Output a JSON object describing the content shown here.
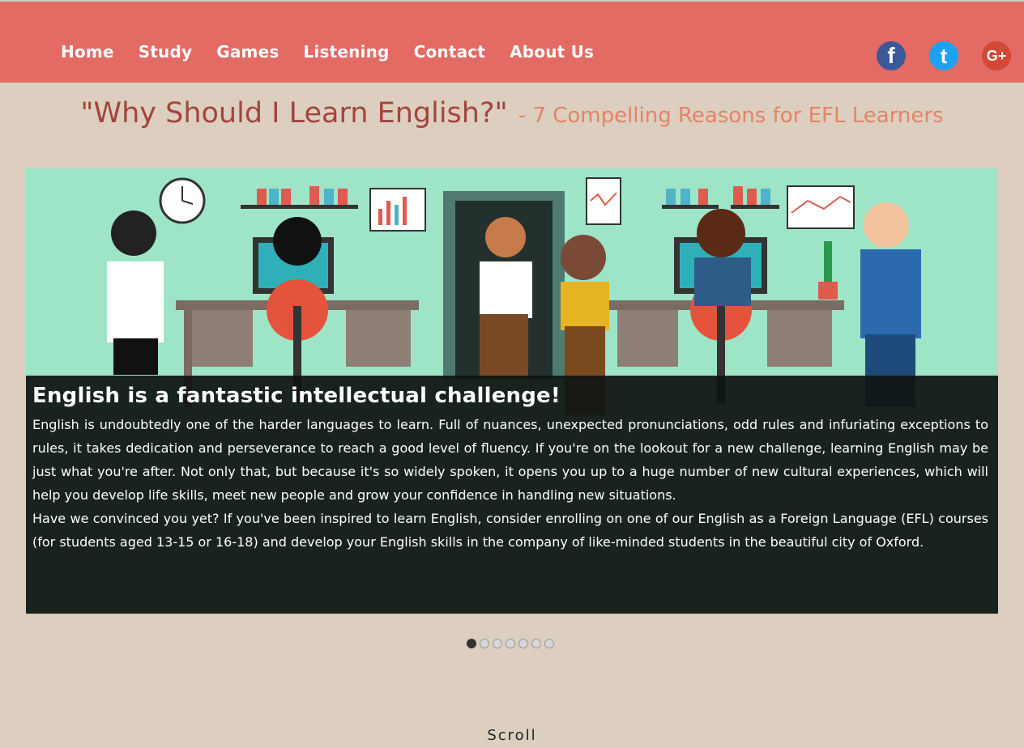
{
  "nav": {
    "items": [
      {
        "label": "Home"
      },
      {
        "label": "Study"
      },
      {
        "label": "Games"
      },
      {
        "label": "Listening"
      },
      {
        "label": "Contact"
      },
      {
        "label": "About Us"
      }
    ]
  },
  "social": {
    "facebook": "f",
    "twitter": "t",
    "googleplus": "G+"
  },
  "headline": {
    "main": "\"Why Should I Learn English?\"",
    "sub": "- 7 Compelling Reasons for EFL Learners"
  },
  "slide": {
    "title": "English is a fantastic intellectual challenge!",
    "paragraph1": "English is undoubtedly one of the harder languages to learn. Full of nuances, unexpected pronunciations, odd rules and infuriating exceptions to rules, it takes dedication and perseverance to reach a good level of fluency. If you're on the lookout for a new challenge, learning English may be just what you're after. Not only that, but because it's so widely spoken, it opens you up to a huge number of new cultural experiences, which will help you develop life skills, meet new people and grow your confidence in handling new situations.",
    "paragraph2": "Have we convinced you yet? If you've been inspired to learn English, consider enrolling on one of our English as a Foreign Language (EFL) courses (for students aged 13-15 or 16-18) and develop your English skills in the company of like-minded students in the beautiful city of Oxford."
  },
  "slider": {
    "total_slides": 7,
    "active_index": 0
  },
  "footer": {
    "scroll_label": "Scroll"
  },
  "colors": {
    "topbar": "#e46a64",
    "background": "#dccfbf",
    "headline_main": "#a5443d",
    "headline_sub": "#e38467"
  }
}
